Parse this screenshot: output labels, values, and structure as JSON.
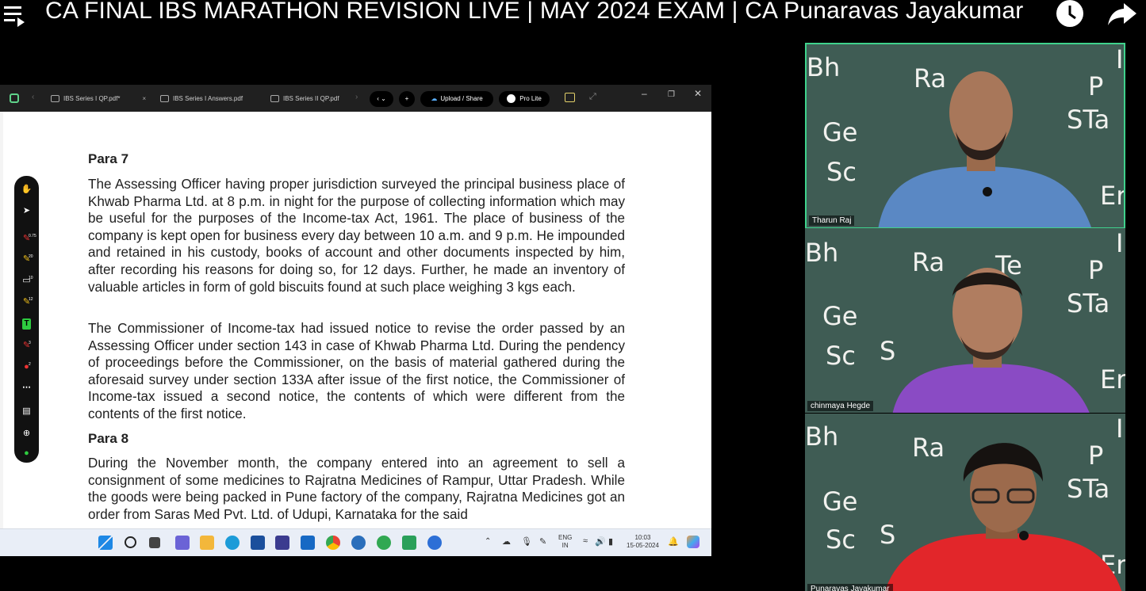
{
  "video": {
    "title": "CA FINAL IBS MARATHON REVISION LIVE | MAY 2024 EXAM | CA Punaravas Jayakumar",
    "icons": [
      "menu-play-icon",
      "clock-icon",
      "share-arrow-icon"
    ]
  },
  "browser": {
    "tabs": [
      {
        "label": "IBS Series I QP.pdf*"
      },
      {
        "label": "IBS Series I Answers.pdf"
      },
      {
        "label": "IBS Series II QP.pdf"
      }
    ],
    "upload_label": "Upload / Share",
    "pro_label": "Pro Lite"
  },
  "document": {
    "para7_heading": "Para 7",
    "para7_text": "The Assessing Officer having proper jurisdiction surveyed the principal business place of Khwab Pharma Ltd. at 8 p.m. in night for the purpose of collecting information which may be useful for the purposes of the Income-tax Act, 1961. The place of business of the company is kept open for business every day between 10 a.m. and 9 p.m. He impounded and retained in his custody, books of account and other documents inspected by him, after recording his reasons for doing so, for 12 days. Further, he made an inventory of valuable articles in form of gold biscuits found at such place weighing 3 kgs each.",
    "para7_text2": "The Commissioner of Income-tax had issued notice to revise the order passed by an Assessing Officer under section 143 in case of Khwab Pharma Ltd. During the pendency of proceedings before the Commissioner, on the basis of material gathered during the aforesaid survey under section 133A after issue of the first notice, the Commissioner of Income-tax issued a second notice, the contents of which were different from the contents of the first notice.",
    "para8_heading": "Para 8",
    "para8_text": "During the November month, the company entered into an agreement to sell a consignment of some medicines to Rajratna Medicines of Rampur, Uttar Pradesh. While the goods were being packed in Pune factory of the company, Rajratna Medicines got an order from Saras Med Pvt. Ltd. of Udupi, Karnataka for the said"
  },
  "annotation_toolbar": {
    "tools": [
      "hand-icon",
      "pointer-icon",
      "pen-icon",
      "highlighter-icon",
      "eraser-icon",
      "marker-icon",
      "text-icon",
      "red-pen-icon",
      "color-picker-icon",
      "more-icon",
      "notes-icon",
      "add-icon",
      "exit-icon"
    ],
    "badges": [
      "0.75",
      "20",
      "10",
      "12",
      "3",
      "2"
    ]
  },
  "taskbar": {
    "language": "ENG",
    "region": "IN",
    "time": "10:03",
    "date": "15-05-2024"
  },
  "participants": [
    {
      "name": "Tharun Raj"
    },
    {
      "name": "chinmaya Hegde"
    },
    {
      "name": "Punaravas Jayakumar"
    }
  ],
  "chalkboard_words": [
    "Bh",
    "Ra",
    "Te",
    "P",
    "STa",
    "Ge",
    "Sc",
    "S",
    "Er",
    "In",
    "r"
  ]
}
